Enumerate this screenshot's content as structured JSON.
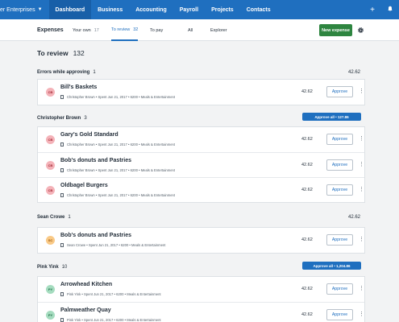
{
  "nav": {
    "org": "er Enterprises",
    "links": [
      "Dashboard",
      "Business",
      "Accounting",
      "Payroll",
      "Projects",
      "Contacts"
    ],
    "plus": "+"
  },
  "subbar": {
    "title": "Expenses",
    "tabs": [
      {
        "label": "Your own",
        "count": "17"
      },
      {
        "label": "To review",
        "count": "32"
      },
      {
        "label": "To pay",
        "count": ""
      },
      {
        "label": "All",
        "count": ""
      },
      {
        "label": "Explorer",
        "count": ""
      }
    ],
    "new_button": "New expense"
  },
  "review": {
    "title": "To review",
    "count": "132"
  },
  "groups": [
    {
      "name": "Errors while approving",
      "count": "1",
      "total": "42.62",
      "approve_all": "",
      "rows": [
        {
          "initials": "CB",
          "vendor": "Bill's Baskets",
          "meta": "Christopher Brown • Spent Jun 21, 2017 • 6200 • Meals & Entertainment",
          "amount": "42.62",
          "approve": "Approve"
        }
      ]
    },
    {
      "name": "Christopher Brown",
      "count": "3",
      "total": "",
      "approve_all": "Approve all • 127.86",
      "rows": [
        {
          "initials": "CB",
          "vendor": "Gary's Gold Standard",
          "meta": "Christopher Brown • Spent Jun 21, 2017 • 6200 • Meals & Entertainment",
          "amount": "42.62",
          "approve": "Approve"
        },
        {
          "initials": "CB",
          "vendor": "Bob's donuts and Pastries",
          "meta": "Christopher Brown • Spent Jun 21, 2017 • 6200 • Meals & Entertainment",
          "amount": "42.62",
          "approve": "Approve"
        },
        {
          "initials": "CB",
          "vendor": "Oldbagel Burgers",
          "meta": "Christopher Brown • Spent Jun 21, 2017 • 6200 • Meals & Entertainment",
          "amount": "42.62",
          "approve": "Approve"
        }
      ]
    },
    {
      "name": "Sean Crowe",
      "count": "1",
      "total": "42.62",
      "approve_all": "",
      "rows": [
        {
          "initials": "SC",
          "vendor": "Bob's donuts and Pastries",
          "meta": "Sean Crowe • Spent Jun 21, 2017 • 6200 • Meals & Entertainment",
          "amount": "42.62",
          "approve": "Approve"
        }
      ]
    },
    {
      "name": "Pink Yink",
      "count": "10",
      "total": "",
      "approve_all": "Approve all • 1,204.86",
      "rows": [
        {
          "initials": "PY",
          "vendor": "Arrowhead Kitchen",
          "meta": "Pink Yink • Spent Jun 21, 2017 • 6200 • Meals & Entertainment",
          "amount": "42.62",
          "approve": "Approve"
        },
        {
          "initials": "PY",
          "vendor": "Palmweather Quay",
          "meta": "Pink Yink • Spent Jun 21, 2017 • 6200 • Meals & Entertainment",
          "amount": "42.62",
          "approve": "Approve"
        }
      ]
    }
  ],
  "icons": {
    "caret": "caret-down-icon",
    "bell": "bell-icon",
    "gear": "gear-icon",
    "doc": "document-icon",
    "kebab": "kebab-icon"
  },
  "colors": {
    "nav": "#1f6fbf",
    "new_button": "#2e8540",
    "approve_all": "#1f6fbf"
  }
}
